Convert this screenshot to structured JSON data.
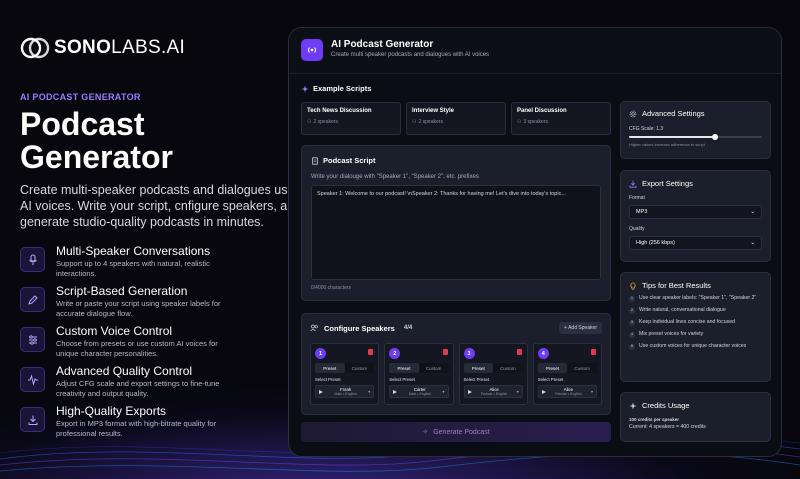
{
  "brand": {
    "name_bold": "SONO",
    "name_light": "LABS.AI"
  },
  "hero": {
    "eyebrow": "AI PODCAST GENERATOR",
    "title": "Podcast Generator",
    "description": "Create multi-speaker podcasts and dialogues using AI voices. Write your script, cnfigure speakers, and generate studio-quality podcasts in minutes."
  },
  "features": [
    {
      "icon": "microphone-icon",
      "title": "Multi-Speaker Conversations",
      "desc": "Support up to 4 speakers with natural, realistic interactions."
    },
    {
      "icon": "pen-icon",
      "title": "Script-Based Generation",
      "desc": "Write or paste your script using speaker labels for accurate dialogue flow."
    },
    {
      "icon": "sliders-icon",
      "title": "Custom Voice Control",
      "desc": "Choose from presets or use custom AI voices for unique character personalities."
    },
    {
      "icon": "waveform-icon",
      "title": "Advanced Quality Control",
      "desc": "Adjust CFG scale and export settings to fine-tune creativity and output quality."
    },
    {
      "icon": "download-icon",
      "title": "High-Quality Exports",
      "desc": "Export in MP3 format with high-bitrate quality for professional results."
    }
  ],
  "app": {
    "title": "AI Podcast Generator",
    "subtitle": "Create multi  speaker podcasts and dialogues with AI voices",
    "examples": {
      "heading": "Example Scripts",
      "items": [
        {
          "title": "Tech News Discussion",
          "meta": "2 speakers"
        },
        {
          "title": "Interview Style",
          "meta": "2 speakers"
        },
        {
          "title": "Panel Discussion",
          "meta": "3 speakers"
        }
      ]
    },
    "script": {
      "heading": "Podcast Script",
      "hint": "Write your dialouge with \"Speaker 1\", \"Speaker 2\", etc. prefixes",
      "value": "Speaker 1: Welcome to our podcast! \\nSpeaker 2: Thanks for having me! Let's dive into today's topic...",
      "char_count": "0/4000 characters"
    },
    "speakers": {
      "heading": "Configure Speakers",
      "count": "4/4",
      "add_label": "+ Add Speaker",
      "tab_preset": "Preset",
      "tab_custom": "Custom",
      "select_label": "Select Preset",
      "items": [
        {
          "num": "1",
          "name": "Frank",
          "meta": "Male • English"
        },
        {
          "num": "2",
          "name": "Carter",
          "meta": "Male • English"
        },
        {
          "num": "3",
          "name": "Alice",
          "meta": "Female • English"
        },
        {
          "num": "4",
          "name": "Alice",
          "meta": "Female • English"
        }
      ]
    },
    "generate_label": "Generate Podcast",
    "advanced": {
      "heading": "Advanced Settings",
      "cfg_label": "CFG Scale: 1.3",
      "cfg_fraction": 0.65,
      "cfg_note": "Higher values increase adherence to script"
    },
    "export": {
      "heading": "Export Settings",
      "format_label": "Format",
      "format_value": "MP3",
      "quality_label": "Quality",
      "quality_value": "High (256 kbps)"
    },
    "tips": {
      "heading": "Tips for Best Results",
      "items": [
        "Use clear speaker labels: \"Speaker 1\", \"Speaker 2\"",
        "Write natural, conversational dialogue",
        "Keep individual lines concise and focused",
        "Mix preset voices for variety",
        "Use custom voices for unique character voices"
      ]
    },
    "credits": {
      "heading": "Credits Usage",
      "per_speaker": "100 credits per speaker",
      "current": "Current: 4 speakers = 400 credits"
    }
  },
  "colors": {
    "accent": "#6d3df5",
    "eyebrow": "#9b7bff",
    "danger": "#e23a4d",
    "tip_icon": "#f5a623"
  }
}
